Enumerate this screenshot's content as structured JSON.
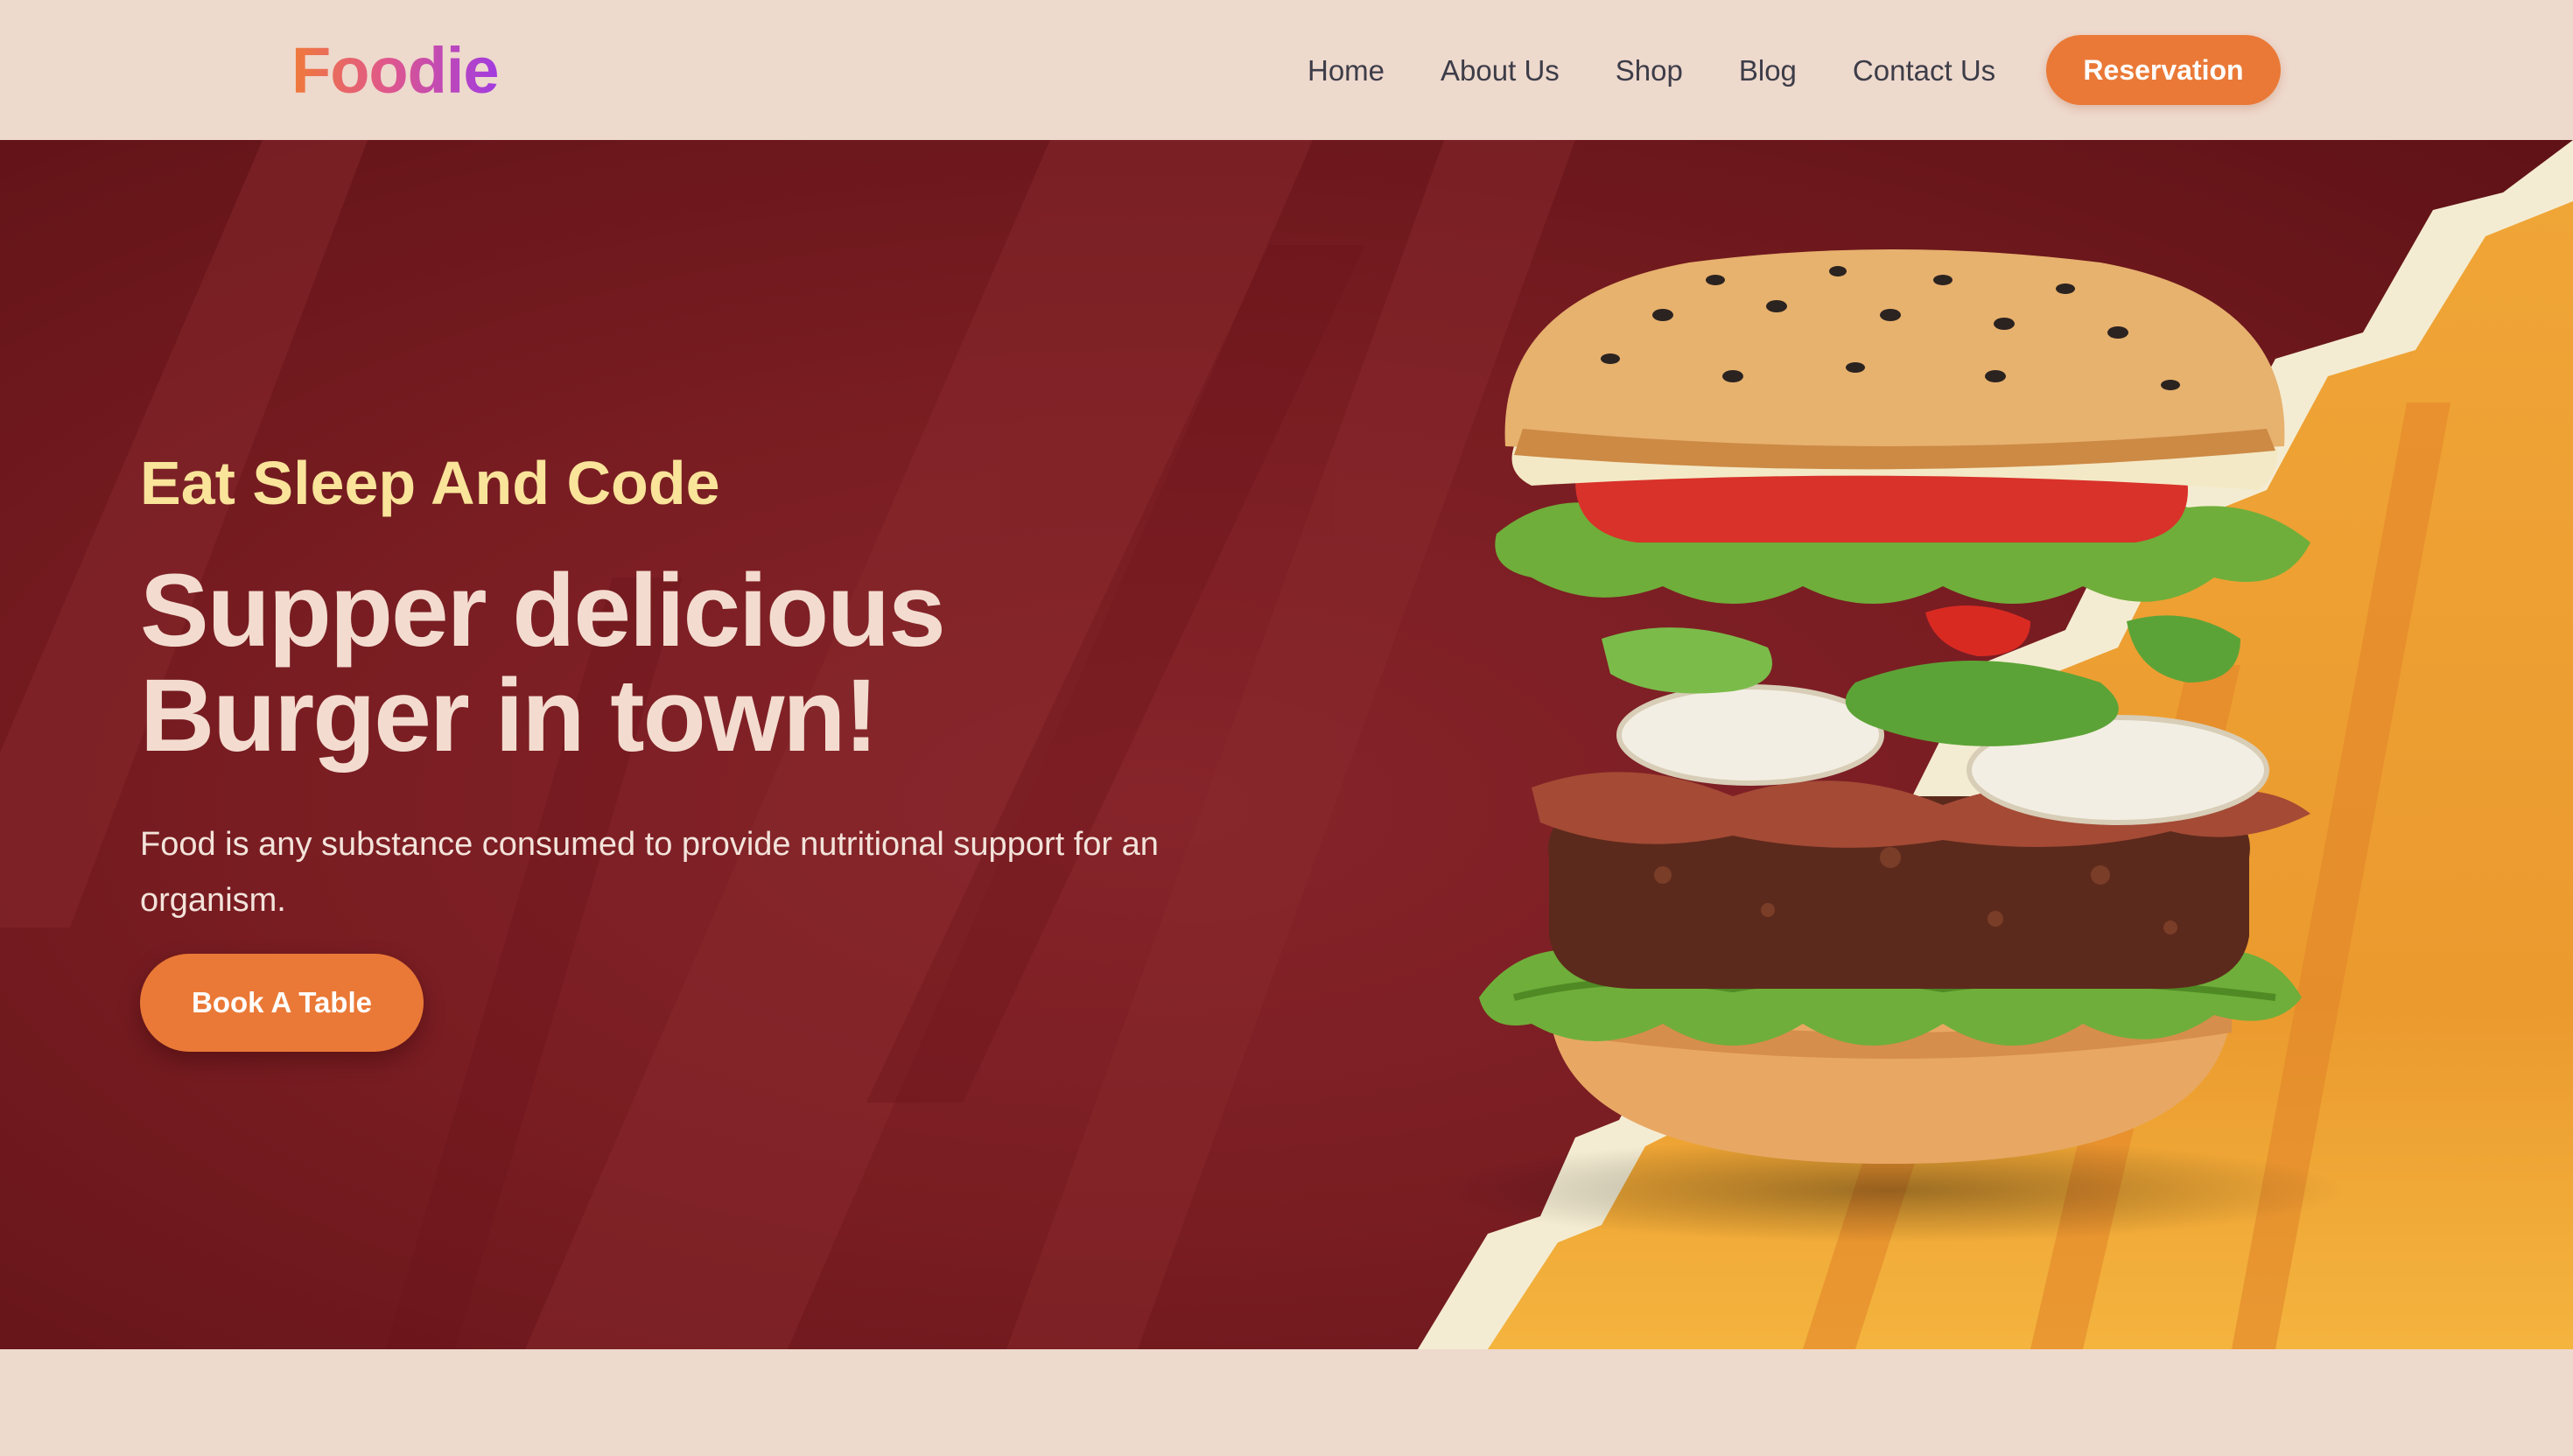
{
  "header": {
    "logo": "Foodie",
    "nav": [
      {
        "label": "Home"
      },
      {
        "label": "About Us"
      },
      {
        "label": "Shop"
      },
      {
        "label": "Blog"
      },
      {
        "label": "Contact Us"
      }
    ],
    "cta_label": "Reservation"
  },
  "hero": {
    "tagline": "Eat Sleep And Code",
    "headline_line1": "Supper delicious",
    "headline_line2": "Burger in town!",
    "description": "Food is any substance consumed to provide nutritional support for an organism.",
    "cta_label": "Book A Table"
  },
  "colors": {
    "page_bg": "#eed9cd",
    "hero_bg": "#7a1e23",
    "accent": "#ea7937",
    "tagline": "#f9e49a",
    "headline": "#f3dccf",
    "yellow_panel": "#eea133"
  },
  "icons": {
    "burger_image": "burger-image"
  }
}
